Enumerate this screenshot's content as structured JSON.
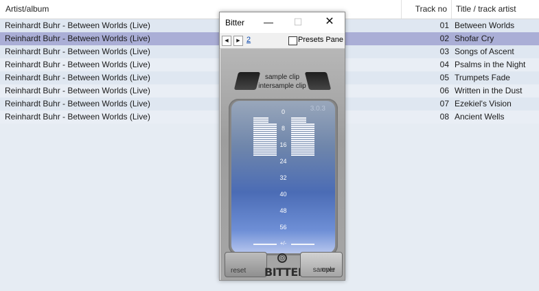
{
  "columns": {
    "artist": "Artist/album",
    "track_no": "Track no",
    "title": "Title / track artist"
  },
  "rows": [
    {
      "artist": "Reinhardt Buhr - Between Worlds (Live)",
      "no": "01",
      "title": "Between Worlds"
    },
    {
      "artist": "Reinhardt Buhr - Between Worlds (Live)",
      "no": "02",
      "title": "Shofar Cry"
    },
    {
      "artist": "Reinhardt Buhr - Between Worlds (Live)",
      "no": "03",
      "title": "Songs of Ascent"
    },
    {
      "artist": "Reinhardt Buhr - Between Worlds (Live)",
      "no": "04",
      "title": "Psalms in the Night"
    },
    {
      "artist": "Reinhardt Buhr - Between Worlds (Live)",
      "no": "05",
      "title": "Trumpets Fade"
    },
    {
      "artist": "Reinhardt Buhr - Between Worlds (Live)",
      "no": "06",
      "title": "Written in the Dust"
    },
    {
      "artist": "Reinhardt Buhr - Between Worlds (Live)",
      "no": "07",
      "title": "Ezekiel's Vision"
    },
    {
      "artist": "Reinhardt Buhr - Between Worlds (Live)",
      "no": "08",
      "title": "Ancient Wells"
    }
  ],
  "selected_row": 1,
  "plugin": {
    "window_title": "Bitter",
    "minimize_icon": "—",
    "maximize_icon": "☐",
    "close_icon": "✕",
    "prev_icon": "◀",
    "next_icon": "▶",
    "preset_number": "2",
    "presets_pane_label": "Presets Pane",
    "sample_clip_label": "sample clip",
    "intersample_clip_label": "intersample clip",
    "version": "3.0.3",
    "scale": [
      "0",
      "8",
      "16",
      "24",
      "32",
      "40",
      "48",
      "56"
    ],
    "plus_minus": "+/-",
    "reset_label": "reset",
    "over_label": "over",
    "sample_label": "sample",
    "logo_text": "BITTER",
    "logo_icon": "☉"
  }
}
